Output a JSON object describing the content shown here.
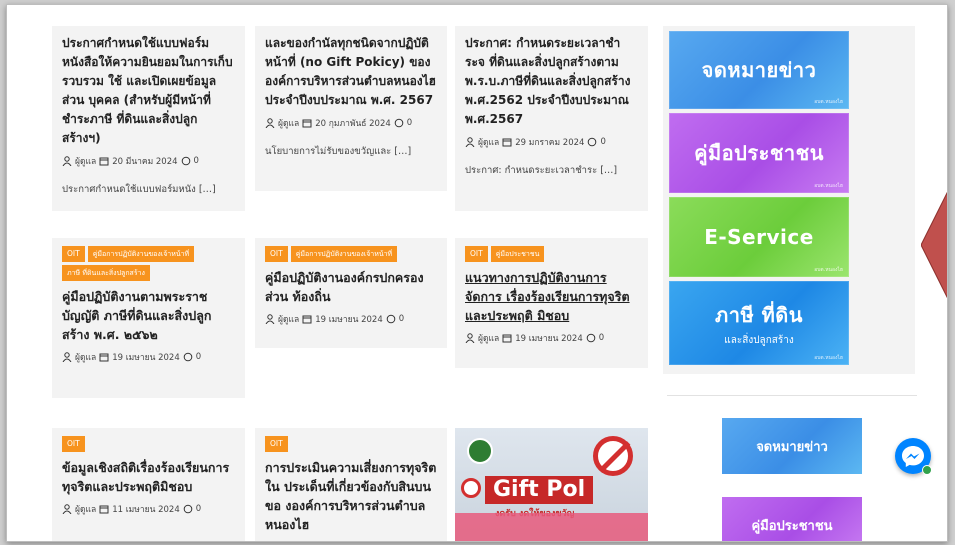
{
  "cards": [
    {
      "tags": [],
      "title": "ประกาศกำหนดใช้แบบฟอร์ม หนังสือให้ความยินยอมในการเก็บ รวบรวม ใช้ และเปิดเผยข้อมูลส่วน บุคคล (สำหรับผู้มีหน้าที่ ชำระภาษี ที่ดินและสิ่งปลูกสร้างฯ)",
      "author": "ผู้ดูแล",
      "date": "20 มีนาคม 2024",
      "comments": "0",
      "excerpt": "ประกาศกำหนดใช้แบบฟอร์มหนัง […]"
    },
    {
      "tags": [],
      "title": "และของกำนัลทุกชนิดจากปฏิบัติ หน้าที่ (no Gift Pokicy) ของ องค์การบริหารส่วนตำบลหนองไฮ ประจำปีงบประมาณ พ.ศ. 2567",
      "author": "ผู้ดูแล",
      "date": "20 กุมภาพันธ์ 2024",
      "comments": "0",
      "excerpt": "นโยบายการไม่รับของขวัญและ […]"
    },
    {
      "tags": [],
      "title": "ประกาศ: กำหนดระยะเวลาชำระจ ที่ดินและสิ่งปลูกสร้างตาม พ.ร.บ.ภาษีที่ดินและสิ่งปลูกสร้าง พ.ศ.2562 ประจำปีงบประมาณ พ.ศ.2567",
      "author": "ผู้ดูแล",
      "date": "29 มกราคม 2024",
      "comments": "0",
      "excerpt": "ประกาศ: กำหนดระยะเวลาชำระ […]"
    },
    {
      "tags": [
        "OIT",
        "คู่มือการปฏิบัติงานของเจ้าหน้าที่",
        "ภาษี ที่ดินและสิ่งปลูกสร้าง"
      ],
      "title": "คู่มือปฏิบัติงานตามพระราชบัญญัติ ภาษีที่ดินและสิ่งปลูกสร้าง พ.ศ. ๒๕๖๒",
      "author": "ผู้ดูแล",
      "date": "19 เมษายน 2024",
      "comments": "0"
    },
    {
      "tags": [
        "OIT",
        "คู่มือการปฏิบัติงานของเจ้าหน้าที่"
      ],
      "title": "คู่มือปฏิบัติงานองค์กรปกครองส่วน ท้องถิ่น",
      "author": "ผู้ดูแล",
      "date": "19 เมษายน 2024",
      "comments": "0"
    },
    {
      "tags": [
        "OIT",
        "คู่มือประชาชน"
      ],
      "title": "แนวทางการปฏิบัติงานการจัดการ เรื่องร้องเรียนการทุจริตและประพฤติ มิชอบ",
      "author": "ผู้ดูแล",
      "date": "19 เมษายน 2024",
      "comments": "0"
    },
    {
      "tags": [
        "OIT"
      ],
      "title": "ข้อมูลเชิงสถิติเรื่องร้องเรียนการ ทุจริตและประพฤติมิชอบ",
      "author": "ผู้ดูแล",
      "date": "11 เมษายน 2024",
      "comments": "0"
    },
    {
      "tags": [
        "OIT"
      ],
      "title": "การประเมินความเสี่ยงการทุจริตใน ประเด็นที่เกี่ยวข้องกับสินบนขอ งองค์การบริหารส่วนตำบลหนองไฮ"
    }
  ],
  "gift_image": {
    "text": "Gift Pol",
    "subtext": "งดรับ งดให้ของขวัญ"
  },
  "banners": [
    {
      "big": "จดหมายข่าว",
      "small": "",
      "corner": "อบต.หนองไฮ"
    },
    {
      "big": "คู่มือประชาชน",
      "small": "",
      "corner": "อบต.หนองไฮ"
    },
    {
      "big": "E-Service",
      "small": "",
      "corner": "อบต.หนองไฮ"
    },
    {
      "big": "ภาษี ที่ดิน",
      "small": "และสิ่งปลูกสร้าง",
      "corner": "อบต.หนองไฮ"
    }
  ],
  "small_banners": [
    {
      "label": "จดหมายข่าว"
    },
    {
      "label": "คู่มือประชาชน"
    }
  ],
  "colors": {
    "tag": "#f7931e",
    "messenger": "#0084ff",
    "arrow": "#c0504d"
  },
  "icons": {
    "author": "user-icon",
    "date": "calendar-icon",
    "comments": "comment-icon",
    "messenger": "messenger-icon"
  }
}
